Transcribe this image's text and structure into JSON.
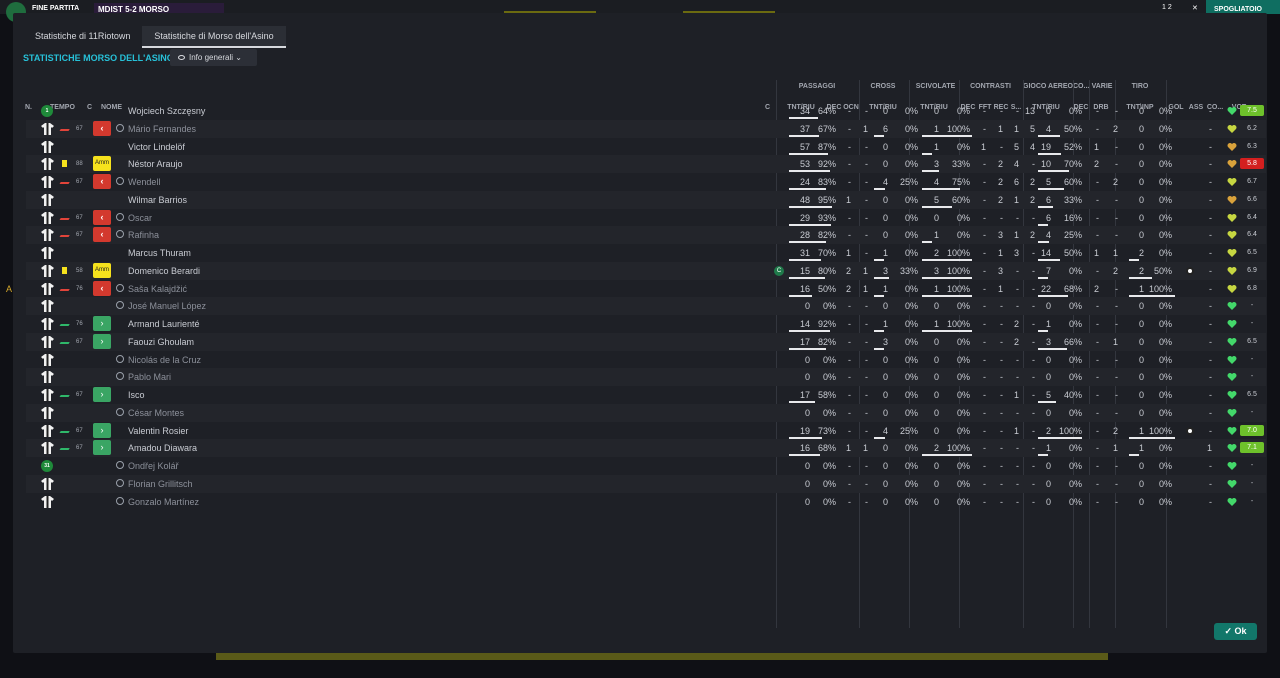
{
  "topbar": {
    "phase": "FINE PARTITA",
    "score": "MDIST  5-2  MORSO",
    "button": "SPOGLIATOIO",
    "counter": "1 2",
    "close": "✕"
  },
  "side_marker": "A",
  "tabs": [
    {
      "label": "Statistiche di 11Riotown",
      "active": false
    },
    {
      "label": "Statistiche di Morso dell'Asino",
      "active": true
    }
  ],
  "section_title": "STATISTICHE MORSO DELL'ASINO",
  "dropdown": "Info generali",
  "colors": {
    "accent": "#27c1d8",
    "sub_out": "#d3392e",
    "sub_in": "#3aa564",
    "vote_good": "#6ec12b",
    "vote_bad": "#d31f1f"
  },
  "headers": {
    "left": {
      "n": "N.",
      "tempo": "TEMPO",
      "c": "C",
      "nome": "NOME",
      "cap": "C"
    },
    "groups": {
      "passaggi": "PASSAGGI",
      "cross": "CROSS",
      "scivolate": "SCIVOLATE",
      "contrasti": "CONTRASTI",
      "aereo": "GIOCO AEREO",
      "co": "CO...",
      "varie": "VARIE",
      "tiro": "TIRO"
    },
    "subs": {
      "p_tnt": "TNT/RIU",
      "p_dec": "DEC",
      "p_ocn": "OCN",
      "c_tnt": "TNT/RIU",
      "s_tnt": "TNT/RIU",
      "k_dec": "DEC",
      "k_fft": "FFT",
      "k_rec": "REC",
      "k_s": "S...",
      "a_tnt": "TNT/RIU",
      "co_dec": "DEC",
      "v_drb": "DRB",
      "t_tnt": "TNT\\INP",
      "gol": "GOL",
      "ass": "ASS",
      "co2": "CO...",
      "vot": "VOT"
    }
  },
  "players": [
    {
      "n": "1",
      "shirt": "badge",
      "tempo": "",
      "ind": "",
      "name": "Wojciech Szczęsny",
      "dim": false,
      "pa": "34",
      "pp": "64%",
      "pdec": "-",
      "pocn": "-",
      "ca": "0",
      "cp": "0%",
      "sa": "0",
      "sp": "0%",
      "kdec": "-",
      "kfft": "-",
      "krec": "-",
      "ks": "13",
      "aa": "0",
      "ap": "0%",
      "codec": "-",
      "drb": "-",
      "ta": "0",
      "tp": "0%",
      "gol": "",
      "ass": "-",
      "vote": "7.5",
      "vc": "g",
      "heart": "#43d86a"
    },
    {
      "n": "",
      "shirt": "white",
      "tempo": "67",
      "ind": "sub",
      "name": "Mário Fernandes",
      "dim": true,
      "pa": "37",
      "pp": "67%",
      "pdec": "-",
      "pocn": "1",
      "ca": "6",
      "cp": "0%",
      "sa": "1",
      "sp": "100%",
      "kdec": "-",
      "kfft": "1",
      "krec": "1",
      "ks": "5",
      "aa": "4",
      "ap": "50%",
      "codec": "-",
      "drb": "2",
      "ta": "0",
      "tp": "0%",
      "gol": "",
      "ass": "-",
      "vote": "6.2",
      "vc": "",
      "heart": "#c6d641"
    },
    {
      "n": "",
      "shirt": "white",
      "tempo": "",
      "ind": "",
      "name": "Victor Lindelöf",
      "dim": false,
      "pa": "57",
      "pp": "87%",
      "pdec": "-",
      "pocn": "-",
      "ca": "0",
      "cp": "0%",
      "sa": "1",
      "sp": "0%",
      "kdec": "1",
      "kfft": "-",
      "krec": "5",
      "ks": "4",
      "aa": "19",
      "ap": "52%",
      "codec": "1",
      "drb": "-",
      "ta": "0",
      "tp": "0%",
      "gol": "",
      "ass": "-",
      "vote": "6.3",
      "vc": "",
      "heart": "#d9a23b"
    },
    {
      "n": "",
      "shirt": "white",
      "tempo": "88",
      "ind": "amm",
      "ycard": true,
      "name": "Néstor Araujo",
      "dim": false,
      "pa": "53",
      "pp": "92%",
      "pdec": "-",
      "pocn": "-",
      "ca": "0",
      "cp": "0%",
      "sa": "3",
      "sp": "33%",
      "kdec": "-",
      "kfft": "2",
      "krec": "4",
      "ks": "-",
      "aa": "10",
      "ap": "70%",
      "codec": "2",
      "drb": "-",
      "ta": "0",
      "tp": "0%",
      "gol": "",
      "ass": "-",
      "vote": "5.8",
      "vc": "r",
      "heart": "#d9a23b"
    },
    {
      "n": "",
      "shirt": "white",
      "tempo": "67",
      "ind": "sub",
      "name": "Wendell",
      "dim": true,
      "pa": "24",
      "pp": "83%",
      "pdec": "-",
      "pocn": "-",
      "ca": "4",
      "cp": "25%",
      "sa": "4",
      "sp": "75%",
      "kdec": "-",
      "kfft": "2",
      "krec": "6",
      "ks": "2",
      "aa": "5",
      "ap": "60%",
      "codec": "-",
      "drb": "2",
      "ta": "0",
      "tp": "0%",
      "gol": "",
      "ass": "-",
      "vote": "6.7",
      "vc": "",
      "heart": "#c6d641"
    },
    {
      "n": "",
      "shirt": "white",
      "tempo": "",
      "ind": "",
      "name": "Wilmar Barrios",
      "dim": false,
      "pa": "48",
      "pp": "95%",
      "pdec": "1",
      "pocn": "-",
      "ca": "0",
      "cp": "0%",
      "sa": "5",
      "sp": "60%",
      "kdec": "-",
      "kfft": "2",
      "krec": "1",
      "ks": "2",
      "aa": "6",
      "ap": "33%",
      "codec": "-",
      "drb": "-",
      "ta": "0",
      "tp": "0%",
      "gol": "",
      "ass": "-",
      "vote": "6.6",
      "vc": "",
      "heart": "#d9a23b"
    },
    {
      "n": "",
      "shirt": "white",
      "tempo": "67",
      "ind": "sub",
      "name": "Oscar",
      "dim": true,
      "pa": "29",
      "pp": "93%",
      "pdec": "-",
      "pocn": "-",
      "ca": "0",
      "cp": "0%",
      "sa": "0",
      "sp": "0%",
      "kdec": "-",
      "kfft": "-",
      "krec": "-",
      "ks": "-",
      "aa": "6",
      "ap": "16%",
      "codec": "-",
      "drb": "-",
      "ta": "0",
      "tp": "0%",
      "gol": "",
      "ass": "-",
      "vote": "6.4",
      "vc": "",
      "heart": "#c6d641"
    },
    {
      "n": "",
      "shirt": "white",
      "tempo": "67",
      "ind": "sub",
      "name": "Rafinha",
      "dim": true,
      "pa": "28",
      "pp": "82%",
      "pdec": "-",
      "pocn": "-",
      "ca": "0",
      "cp": "0%",
      "sa": "1",
      "sp": "0%",
      "kdec": "-",
      "kfft": "3",
      "krec": "1",
      "ks": "2",
      "aa": "4",
      "ap": "25%",
      "codec": "-",
      "drb": "-",
      "ta": "0",
      "tp": "0%",
      "gol": "",
      "ass": "-",
      "vote": "6.4",
      "vc": "",
      "heart": "#c6d641"
    },
    {
      "n": "",
      "shirt": "white",
      "tempo": "",
      "ind": "",
      "name": "Marcus Thuram",
      "dim": false,
      "pa": "31",
      "pp": "70%",
      "pdec": "1",
      "pocn": "-",
      "ca": "1",
      "cp": "0%",
      "sa": "2",
      "sp": "100%",
      "kdec": "-",
      "kfft": "1",
      "krec": "3",
      "ks": "-",
      "aa": "14",
      "ap": "50%",
      "codec": "1",
      "drb": "1",
      "ta": "2",
      "tp": "0%",
      "gol": "",
      "ass": "-",
      "vote": "6.5",
      "vc": "",
      "heart": "#c6d641"
    },
    {
      "n": "",
      "shirt": "white",
      "tempo": "58",
      "ind": "amm",
      "ycard": true,
      "cap": true,
      "name": "Domenico Berardi",
      "dim": false,
      "pa": "15",
      "pp": "80%",
      "pdec": "2",
      "pocn": "1",
      "ca": "3",
      "cp": "33%",
      "sa": "3",
      "sp": "100%",
      "kdec": "-",
      "kfft": "3",
      "krec": "-",
      "ks": "-",
      "aa": "7",
      "ap": "0%",
      "codec": "-",
      "drb": "2",
      "ta": "2",
      "tp": "50%",
      "gol": "ball",
      "ass": "-",
      "vote": "6.9",
      "vc": "",
      "heart": "#c6d641"
    },
    {
      "n": "",
      "shirt": "white",
      "tempo": "76",
      "ind": "sub",
      "name": "Saša Kalajdžić",
      "dim": true,
      "pa": "16",
      "pp": "50%",
      "pdec": "2",
      "pocn": "1",
      "ca": "1",
      "cp": "0%",
      "sa": "1",
      "sp": "100%",
      "kdec": "-",
      "kfft": "1",
      "krec": "-",
      "ks": "-",
      "aa": "22",
      "ap": "68%",
      "codec": "2",
      "drb": "-",
      "ta": "1",
      "tp": "100%",
      "gol": "",
      "ass": "-",
      "vote": "6.8",
      "vc": "",
      "heart": "#c6d641"
    },
    {
      "n": "",
      "shirt": "white",
      "tempo": "",
      "ind": "",
      "name": "José Manuel López",
      "dim": true,
      "pa": "0",
      "pp": "0%",
      "pdec": "-",
      "pocn": "-",
      "ca": "0",
      "cp": "0%",
      "sa": "0",
      "sp": "0%",
      "kdec": "-",
      "kfft": "-",
      "krec": "-",
      "ks": "-",
      "aa": "0",
      "ap": "0%",
      "codec": "-",
      "drb": "-",
      "ta": "0",
      "tp": "0%",
      "gol": "",
      "ass": "-",
      "vote": "-",
      "vc": "",
      "heart": "#43d86a"
    },
    {
      "n": "",
      "shirt": "white",
      "tempo": "76",
      "ind": "in",
      "name": "Armand Laurienté",
      "dim": false,
      "pa": "14",
      "pp": "92%",
      "pdec": "-",
      "pocn": "-",
      "ca": "1",
      "cp": "0%",
      "sa": "1",
      "sp": "100%",
      "kdec": "-",
      "kfft": "-",
      "krec": "2",
      "ks": "-",
      "aa": "1",
      "ap": "0%",
      "codec": "-",
      "drb": "-",
      "ta": "0",
      "tp": "0%",
      "gol": "",
      "ass": "-",
      "vote": "-",
      "vc": "",
      "heart": "#43d86a"
    },
    {
      "n": "",
      "shirt": "white",
      "tempo": "67",
      "ind": "in",
      "name": "Faouzi Ghoulam",
      "dim": false,
      "pa": "17",
      "pp": "82%",
      "pdec": "-",
      "pocn": "-",
      "ca": "3",
      "cp": "0%",
      "sa": "0",
      "sp": "0%",
      "kdec": "-",
      "kfft": "-",
      "krec": "2",
      "ks": "-",
      "aa": "3",
      "ap": "66%",
      "codec": "-",
      "drb": "1",
      "ta": "0",
      "tp": "0%",
      "gol": "",
      "ass": "-",
      "vote": "6.5",
      "vc": "",
      "heart": "#43d86a"
    },
    {
      "n": "",
      "shirt": "white",
      "tempo": "",
      "ind": "",
      "name": "Nicolás de la Cruz",
      "dim": true,
      "pa": "0",
      "pp": "0%",
      "pdec": "-",
      "pocn": "-",
      "ca": "0",
      "cp": "0%",
      "sa": "0",
      "sp": "0%",
      "kdec": "-",
      "kfft": "-",
      "krec": "-",
      "ks": "-",
      "aa": "0",
      "ap": "0%",
      "codec": "-",
      "drb": "-",
      "ta": "0",
      "tp": "0%",
      "gol": "",
      "ass": "-",
      "vote": "-",
      "vc": "",
      "heart": "#43d86a"
    },
    {
      "n": "",
      "shirt": "white",
      "tempo": "",
      "ind": "",
      "name": "Pablo Mari",
      "dim": true,
      "pa": "0",
      "pp": "0%",
      "pdec": "-",
      "pocn": "-",
      "ca": "0",
      "cp": "0%",
      "sa": "0",
      "sp": "0%",
      "kdec": "-",
      "kfft": "-",
      "krec": "-",
      "ks": "-",
      "aa": "0",
      "ap": "0%",
      "codec": "-",
      "drb": "-",
      "ta": "0",
      "tp": "0%",
      "gol": "",
      "ass": "-",
      "vote": "-",
      "vc": "",
      "heart": "#43d86a"
    },
    {
      "n": "",
      "shirt": "white",
      "tempo": "67",
      "ind": "in",
      "name": "Isco",
      "dim": false,
      "pa": "17",
      "pp": "58%",
      "pdec": "-",
      "pocn": "-",
      "ca": "0",
      "cp": "0%",
      "sa": "0",
      "sp": "0%",
      "kdec": "-",
      "kfft": "-",
      "krec": "1",
      "ks": "-",
      "aa": "5",
      "ap": "40%",
      "codec": "-",
      "drb": "-",
      "ta": "0",
      "tp": "0%",
      "gol": "",
      "ass": "-",
      "vote": "6.5",
      "vc": "",
      "heart": "#43d86a"
    },
    {
      "n": "",
      "shirt": "white",
      "tempo": "",
      "ind": "",
      "name": "César Montes",
      "dim": true,
      "pa": "0",
      "pp": "0%",
      "pdec": "-",
      "pocn": "-",
      "ca": "0",
      "cp": "0%",
      "sa": "0",
      "sp": "0%",
      "kdec": "-",
      "kfft": "-",
      "krec": "-",
      "ks": "-",
      "aa": "0",
      "ap": "0%",
      "codec": "-",
      "drb": "-",
      "ta": "0",
      "tp": "0%",
      "gol": "",
      "ass": "-",
      "vote": "-",
      "vc": "",
      "heart": "#43d86a"
    },
    {
      "n": "",
      "shirt": "white",
      "tempo": "67",
      "ind": "in",
      "name": "Valentin Rosier",
      "dim": false,
      "pa": "19",
      "pp": "73%",
      "pdec": "-",
      "pocn": "-",
      "ca": "4",
      "cp": "25%",
      "sa": "0",
      "sp": "0%",
      "kdec": "-",
      "kfft": "-",
      "krec": "1",
      "ks": "-",
      "aa": "2",
      "ap": "100%",
      "codec": "-",
      "drb": "2",
      "ta": "1",
      "tp": "100%",
      "gol": "ball",
      "ass": "-",
      "vote": "7.0",
      "vc": "g",
      "heart": "#43d86a"
    },
    {
      "n": "",
      "shirt": "white",
      "tempo": "67",
      "ind": "in",
      "name": "Amadou Diawara",
      "dim": false,
      "pa": "16",
      "pp": "68%",
      "pdec": "1",
      "pocn": "1",
      "ca": "0",
      "cp": "0%",
      "sa": "2",
      "sp": "100%",
      "kdec": "-",
      "kfft": "-",
      "krec": "-",
      "ks": "-",
      "aa": "1",
      "ap": "0%",
      "codec": "-",
      "drb": "1",
      "ta": "1",
      "tp": "0%",
      "gol": "",
      "ass": "1",
      "vote": "7.1",
      "vc": "g",
      "heart": "#43d86a"
    },
    {
      "n": "31",
      "shirt": "badge",
      "tempo": "",
      "ind": "",
      "name": "Ondřej Kolář",
      "dim": true,
      "pa": "0",
      "pp": "0%",
      "pdec": "-",
      "pocn": "-",
      "ca": "0",
      "cp": "0%",
      "sa": "0",
      "sp": "0%",
      "kdec": "-",
      "kfft": "-",
      "krec": "-",
      "ks": "-",
      "aa": "0",
      "ap": "0%",
      "codec": "-",
      "drb": "-",
      "ta": "0",
      "tp": "0%",
      "gol": "",
      "ass": "-",
      "vote": "-",
      "vc": "",
      "heart": "#43d86a"
    },
    {
      "n": "",
      "shirt": "white",
      "tempo": "",
      "ind": "",
      "name": "Florian Grillitsch",
      "dim": true,
      "pa": "0",
      "pp": "0%",
      "pdec": "-",
      "pocn": "-",
      "ca": "0",
      "cp": "0%",
      "sa": "0",
      "sp": "0%",
      "kdec": "-",
      "kfft": "-",
      "krec": "-",
      "ks": "-",
      "aa": "0",
      "ap": "0%",
      "codec": "-",
      "drb": "-",
      "ta": "0",
      "tp": "0%",
      "gol": "",
      "ass": "-",
      "vote": "-",
      "vc": "",
      "heart": "#43d86a"
    },
    {
      "n": "",
      "shirt": "white",
      "tempo": "",
      "ind": "",
      "name": "Gonzalo Martínez",
      "dim": true,
      "pa": "0",
      "pp": "0%",
      "pdec": "-",
      "pocn": "-",
      "ca": "0",
      "cp": "0%",
      "sa": "0",
      "sp": "0%",
      "kdec": "-",
      "kfft": "-",
      "krec": "-",
      "ks": "-",
      "aa": "0",
      "ap": "0%",
      "codec": "-",
      "drb": "-",
      "ta": "0",
      "tp": "0%",
      "gol": "",
      "ass": "-",
      "vote": "-",
      "vc": "",
      "heart": "#43d86a"
    }
  ],
  "ok_button": "Ok"
}
